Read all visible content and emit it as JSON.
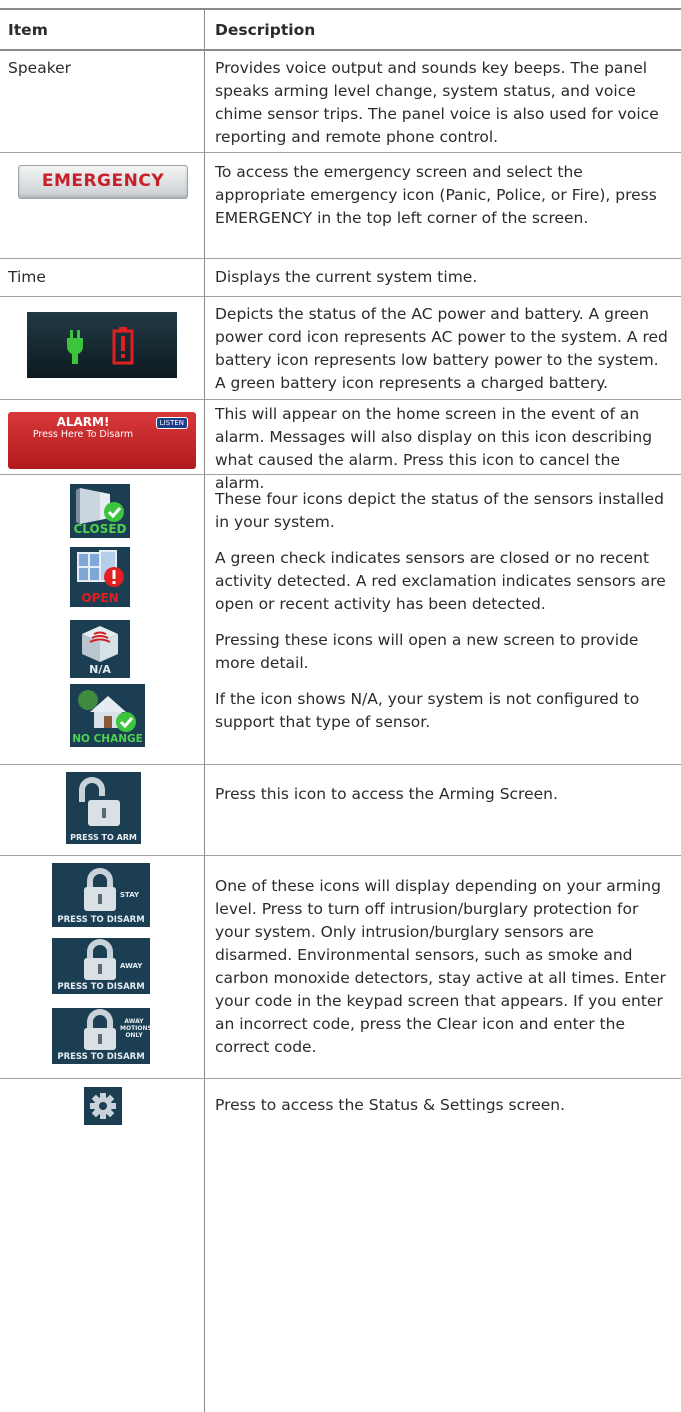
{
  "header": {
    "item": "Item",
    "description": "Description"
  },
  "rows": [
    {
      "item_text": "Speaker",
      "description": [
        "Provides voice output and sounds key beeps. The panel speaks arming level change, system status, and voice chime sensor trips. The panel voice is also used for voice reporting and remote phone control."
      ]
    },
    {
      "icon": "emergency-button-icon",
      "icon_text": "EMERGENCY",
      "description": [
        "To access the emergency screen and select the appropriate emergency icon (Panic, Police, or Fire), press EMERGENCY in the top left corner of the screen."
      ]
    },
    {
      "item_text": "Time",
      "description": [
        "Displays the current system time."
      ]
    },
    {
      "icon": "power-battery-status-icon",
      "description": [
        "Depicts the status of the AC power and battery. A green power cord icon represents AC power to the system. A red battery icon represents low battery power to the system. A green battery icon represents a charged battery."
      ]
    },
    {
      "icon": "alarm-banner-icon",
      "icon_text": "ALARM!",
      "icon_subtext": "Press Here To Disarm",
      "icon_badge": "LISTEN",
      "description": [
        "This will appear on the home screen in the event of an alarm. Messages will also display on this icon describing what caused the alarm. Press this icon to cancel the alarm."
      ]
    },
    {
      "icons": [
        {
          "name": "closed-door-sensor-icon",
          "label": "CLOSED"
        },
        {
          "name": "open-window-sensor-icon",
          "label": "OPEN"
        },
        {
          "name": "motion-sensor-icon",
          "label": "N/A"
        },
        {
          "name": "home-sensor-icon",
          "label": "NO CHANGE"
        }
      ],
      "description": [
        "These four icons depict the status of the sensors installed in your system.",
        "A green check indicates sensors are closed or no recent activity detected.  A red exclamation indicates sensors are open or recent activity has been detected.",
        "Pressing these icons will open a new screen to provide more detail.",
        "If the icon shows N/A, your system is not configured to support that type of sensor."
      ]
    },
    {
      "icon": "unlocked-padlock-icon",
      "icon_text": "PRESS TO ARM",
      "description": [
        "Press this icon to access the Arming Screen."
      ]
    },
    {
      "icons": [
        {
          "name": "locked-padlock-stay-icon",
          "mode": "STAY",
          "label": "PRESS TO DISARM"
        },
        {
          "name": "locked-padlock-away-icon",
          "mode": "AWAY",
          "label": "PRESS TO DISARM"
        },
        {
          "name": "locked-padlock-away-motions-icon",
          "mode": "AWAY MOTIONS ONLY",
          "label": "PRESS TO DISARM"
        }
      ],
      "description": [
        "One of these icons will display depending on your arming level. Press to turn off intrusion/burglary protection for your system. Only intrusion/burglary sensors are disarmed. Environmental sensors, such as smoke and carbon monoxide detectors, stay active at all times. Enter your code in the keypad screen that appears. If you enter an incorrect code, press the Clear icon and enter the correct code."
      ]
    },
    {
      "icon": "gear-icon",
      "description": [
        "Press to access the Status & Settings screen."
      ]
    }
  ],
  "colors": {
    "rule": "#8a8a8a",
    "tile": "#1b3e53",
    "green": "#3cc43c",
    "red": "#e02020",
    "emergency_text": "#c8202a"
  }
}
